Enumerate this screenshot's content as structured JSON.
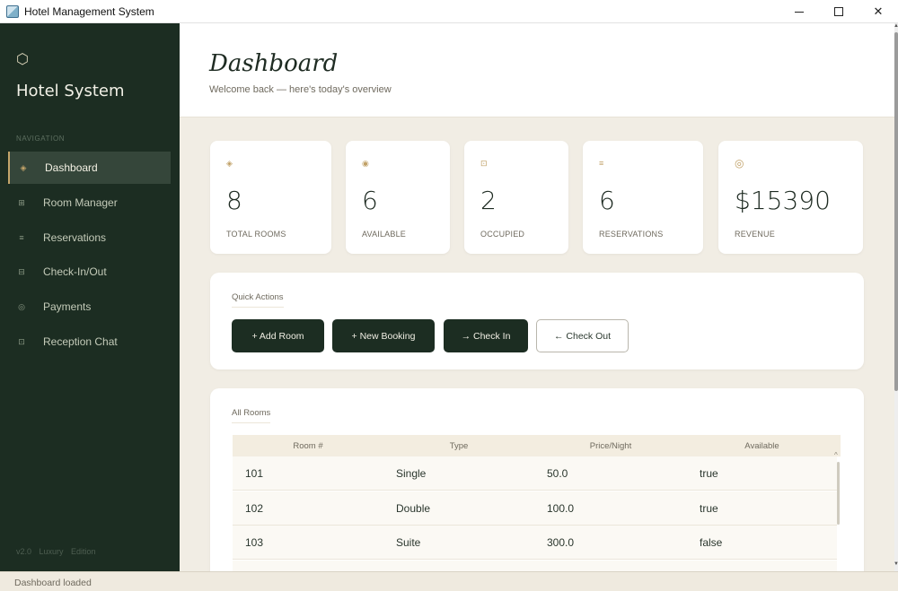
{
  "window": {
    "title": "Hotel Management System",
    "icon": "app-window-icon",
    "controls": [
      "minimize-icon",
      "maximize-icon",
      "close-icon"
    ],
    "close_glyph": "✕"
  },
  "sidebar": {
    "brand_icon": "⬡",
    "brand_name": "Hotel System",
    "nav_heading": "NAVIGATION",
    "items": [
      {
        "icon": "◈",
        "label": "Dashboard",
        "active": true
      },
      {
        "icon": "⊞",
        "label": "Room Manager"
      },
      {
        "icon": "≡",
        "label": "Reservations"
      },
      {
        "icon": "⊟",
        "label": "Check-In/Out"
      },
      {
        "icon": "◎",
        "label": "Payments"
      },
      {
        "icon": "⊡",
        "label": "Reception Chat"
      }
    ],
    "footer": "v2.0  Luxury Edition"
  },
  "header": {
    "title": "Dashboard",
    "subtitle": "Welcome back — here's today's overview"
  },
  "stats": [
    {
      "icon": "◈",
      "value": "8",
      "label": "TOTAL ROOMS"
    },
    {
      "icon": "◉",
      "value": "6",
      "label": "AVAILABLE"
    },
    {
      "icon": "⊡",
      "value": "2",
      "label": "OCCUPIED"
    },
    {
      "icon": "≡",
      "value": "6",
      "label": "RESERVATIONS"
    },
    {
      "icon": "◎",
      "value": "$15390",
      "label": "REVENUE"
    }
  ],
  "quick_actions": {
    "title": "Quick Actions",
    "buttons": [
      "+ Add Room",
      "+ New Booking",
      "→ Check In",
      "← Check Out"
    ]
  },
  "rooms": {
    "title": "All Rooms",
    "columns": [
      "Room #",
      "Type",
      "Price/Night",
      "Available"
    ],
    "rows": [
      [
        "101",
        "Single",
        "50.0",
        "true"
      ],
      [
        "102",
        "Double",
        "100.0",
        "true"
      ],
      [
        "103",
        "Suite",
        "300.0",
        "false"
      ]
    ]
  },
  "status_bar": {
    "text": "Dashboard loaded"
  },
  "colors": {
    "sidebar_bg": "#1c2d22",
    "accent_gold": "#c4a56a",
    "content_bg": "#f1ede4",
    "button_dark": "#1c2d22"
  }
}
